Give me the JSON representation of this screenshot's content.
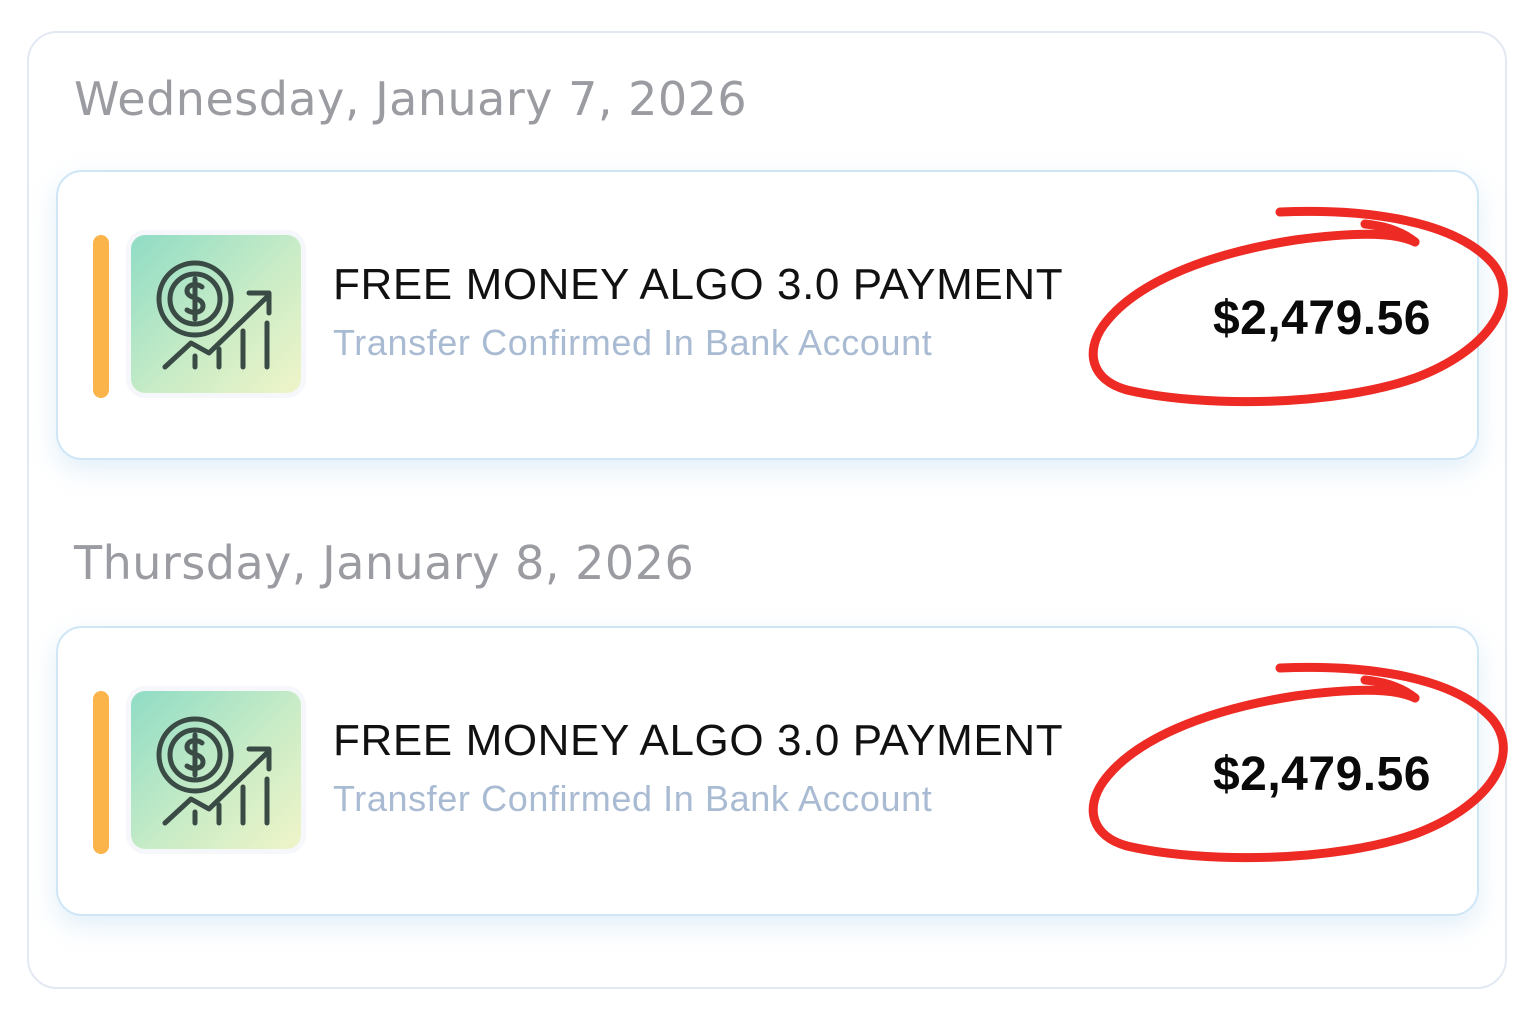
{
  "transactions": [
    {
      "date": "Wednesday, January 7, 2026",
      "title": "FREE MONEY ALGO 3.0 PAYMENT",
      "status": "Transfer Confirmed In Bank Account",
      "amount": "$2,479.56",
      "icon": "dollar-growth-chart-icon",
      "annotation": "red-hand-drawn-circle"
    },
    {
      "date": "Thursday, January 8, 2026",
      "title": "FREE MONEY ALGO 3.0 PAYMENT",
      "status": "Transfer Confirmed In Bank Account",
      "amount": "$2,479.56",
      "icon": "dollar-growth-chart-icon",
      "annotation": "red-hand-drawn-circle"
    }
  ],
  "colors": {
    "accent_bar": "#fbb44a",
    "annotation_red": "#ee2a24",
    "card_border": "#cfe6f7",
    "date_text": "#9b9ca1",
    "status_text": "#a9bbd2"
  }
}
